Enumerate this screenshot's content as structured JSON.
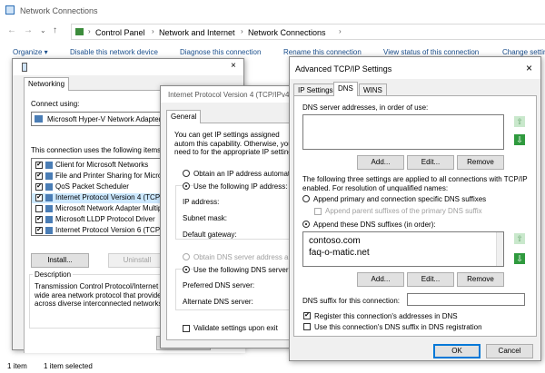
{
  "explorer": {
    "title": "Network Connections",
    "breadcrumb": [
      "Control Panel",
      "Network and Internet",
      "Network Connections"
    ],
    "toolbar": [
      "Organize ▾",
      "Disable this network device",
      "Diagnose this connection",
      "Rename this connection",
      "View status of this connection",
      "Change setting"
    ],
    "status": {
      "count": "1 item",
      "selected": "1 item selected"
    }
  },
  "props": {
    "tab": "Networking",
    "connect_using": "Connect using:",
    "adapter": "Microsoft Hyper-V Network Adapter #",
    "uses_label": "This connection uses the following items:",
    "items": [
      {
        "label": "Client for Microsoft Networks",
        "checked": true
      },
      {
        "label": "File and Printer Sharing for Microso",
        "checked": true
      },
      {
        "label": "QoS Packet Scheduler",
        "checked": true
      },
      {
        "label": "Internet Protocol Version 4 (TCP/IP",
        "checked": true,
        "selected": true
      },
      {
        "label": "Microsoft Network Adapter Multiple",
        "checked": false
      },
      {
        "label": "Microsoft LLDP Protocol Driver",
        "checked": true
      },
      {
        "label": "Internet Protocol Version 6 (TCP/IP",
        "checked": true
      }
    ],
    "install": "Install...",
    "uninstall": "Uninstall",
    "desc_title": "Description",
    "desc_text": "Transmission Control Protocol/Internet Pr wide area network protocol that provides across diverse interconnected networks."
  },
  "ipv4": {
    "title": "Internet Protocol Version 4 (TCP/IPv4",
    "tab": "General",
    "intro": "You can get IP settings assigned autom this capability. Otherwise, you need to for the appropriate IP settings.",
    "obtain_ip": "Obtain an IP address automatica",
    "use_ip": "Use the following IP address:",
    "ip_address": "IP address:",
    "subnet": "Subnet mask:",
    "gateway": "Default gateway:",
    "obtain_dns": "Obtain DNS server address autor",
    "use_dns": "Use the following DNS server addr",
    "preferred": "Preferred DNS server:",
    "alternate": "Alternate DNS server:",
    "validate": "Validate settings upon exit"
  },
  "adv": {
    "title": "Advanced TCP/IP Settings",
    "tabs": [
      "IP Settings",
      "DNS",
      "WINS"
    ],
    "dns_servers_label": "DNS server addresses, in order of use:",
    "add": "Add...",
    "edit": "Edit...",
    "remove": "Remove",
    "info": "The following three settings are applied to all connections with TCP/IP enabled. For resolution of unqualified names:",
    "append_primary": "Append primary and connection specific DNS suffixes",
    "append_parent": "Append parent suffixes of the primary DNS suffix",
    "append_these": "Append these DNS suffixes (in order):",
    "suffixes": [
      "contoso.com",
      "faq-o-matic.net"
    ],
    "suffix_label": "DNS suffix for this connection:",
    "register": "Register this connection's addresses in DNS",
    "use_suffix": "Use this connection's DNS suffix in DNS registration",
    "ok": "OK",
    "cancel": "Cancel"
  }
}
